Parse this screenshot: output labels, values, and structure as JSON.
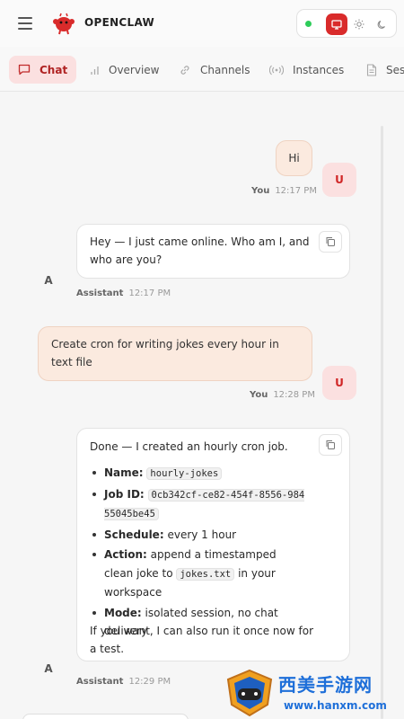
{
  "header": {
    "brand": "OPENCLAW",
    "status_color": "#2ecc5a",
    "accent_color": "#d92b2b"
  },
  "tabs": [
    {
      "label": "Chat",
      "icon": "chat-icon",
      "active": true
    },
    {
      "label": "Overview",
      "icon": "bar-chart-icon"
    },
    {
      "label": "Channels",
      "icon": "link-icon"
    },
    {
      "label": "Instances",
      "icon": "broadcast-icon"
    },
    {
      "label": "Ses",
      "icon": "document-icon"
    }
  ],
  "messages": {
    "m1": {
      "text": "Hi",
      "avatar": "U",
      "sender": "You",
      "time": "12:17 PM"
    },
    "m2": {
      "text": "Hey — I just came online. Who am I, and who are you?",
      "avatar": "A",
      "sender": "Assistant",
      "time": "12:17 PM"
    },
    "m3": {
      "text": "Create cron for writing jokes every hour in text file",
      "avatar": "U",
      "sender": "You",
      "time": "12:28 PM"
    },
    "m4": {
      "intro": "Done — I created an hourly cron job.",
      "name_label": "Name:",
      "name_value": "hourly-jokes",
      "jobid_label": "Job ID:",
      "jobid_value": "0cb342cf-ce82-454f-8556-98455045be45",
      "schedule_label": "Schedule:",
      "schedule_value": "every 1 hour",
      "action_label": "Action:",
      "action_pre": "append a timestamped clean joke to",
      "action_file": "jokes.txt",
      "action_post": "in your workspace",
      "mode_label": "Mode:",
      "mode_value": "isolated session, no chat delivery",
      "outro": "If you want, I can also run it once now for a test.",
      "avatar": "A",
      "sender": "Assistant",
      "time": "12:29 PM"
    }
  },
  "watermark": {
    "text": "西美手游网",
    "url": "www.hanxm.com"
  }
}
